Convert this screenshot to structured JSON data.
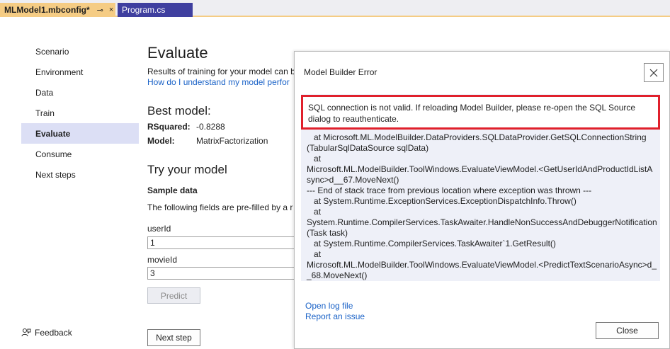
{
  "tabs": [
    {
      "label": "MLModel1.mbconfig*",
      "pin": "⊸",
      "close": "×"
    },
    {
      "label": "Program.cs"
    }
  ],
  "nav": {
    "items": [
      "Scenario",
      "Environment",
      "Data",
      "Train",
      "Evaluate",
      "Consume",
      "Next steps"
    ],
    "selected": "Evaluate",
    "feedback": "Feedback"
  },
  "main": {
    "title": "Evaluate",
    "description": "Results of training for your model can b",
    "help_link": "How do I understand my model perfor",
    "best_model_heading": "Best model:",
    "rsquared_label": "RSquared:",
    "rsquared_value": "-0.8288",
    "model_label": "Model:",
    "model_value": "MatrixFactorization",
    "try_heading": "Try your model",
    "sample_data_label": "Sample data",
    "sample_desc": "The following fields are pre-filled by a r",
    "fields": [
      {
        "label": "userId",
        "value": "1"
      },
      {
        "label": "movieId",
        "value": "3"
      }
    ],
    "predict_label": "Predict",
    "next_step_label": "Next step"
  },
  "dialog": {
    "title": "Model Builder Error",
    "close_icon": "close-icon",
    "error_message": "SQL connection is not valid. If reloading Model Builder, please re-open the SQL Source dialog to reauthenticate.",
    "stack_trace": "   at Microsoft.ML.ModelBuilder.DataProviders.SQLDataProvider.GetSQLConnectionString\n(TabularSqlDataSource sqlData)\n   at\nMicrosoft.ML.ModelBuilder.ToolWindows.EvaluateViewModel.<GetUserIdAndProductIdListA\nsync>d__67.MoveNext()\n--- End of stack trace from previous location where exception was thrown ---\n   at System.Runtime.ExceptionServices.ExceptionDispatchInfo.Throw()\n   at\nSystem.Runtime.CompilerServices.TaskAwaiter.HandleNonSuccessAndDebuggerNotification\n(Task task)\n   at System.Runtime.CompilerServices.TaskAwaiter`1.GetResult()\n   at\nMicrosoft.ML.ModelBuilder.ToolWindows.EvaluateViewModel.<PredictTextScenarioAsync>d_\n_68.MoveNext()",
    "open_log_link": "Open log file",
    "report_link": "Report an issue",
    "close_button": "Close"
  },
  "colors": {
    "accent_tab": "#f5cc84",
    "inactive_tab": "#3f3f9f",
    "nav_selected": "#dcdff5",
    "link": "#1a62c7",
    "error_border": "#e0202c"
  }
}
